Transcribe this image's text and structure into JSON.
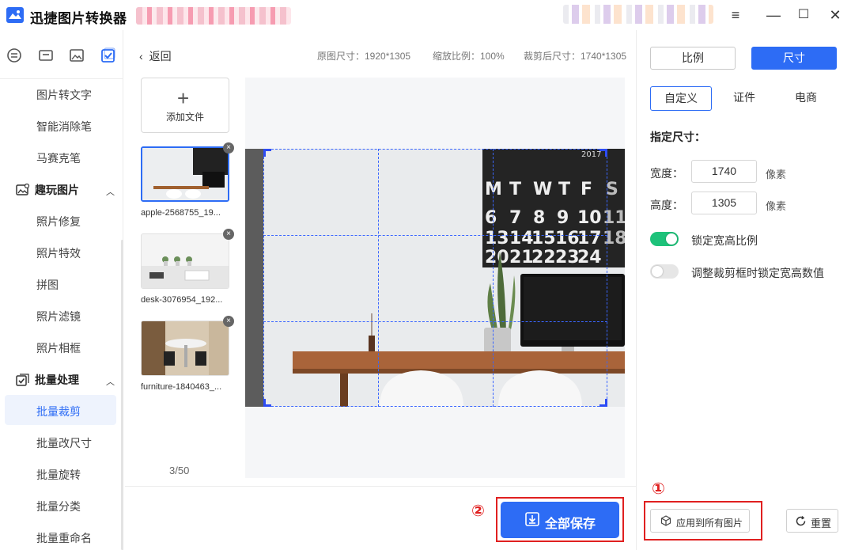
{
  "titlebar": {
    "app_title": "迅捷图片转换器",
    "controls": [
      "≡",
      "—",
      "☐",
      "✕"
    ]
  },
  "sidebar": {
    "top_icons": [
      "convert-icon",
      "layout-icon",
      "image-icon",
      "batch-check-icon"
    ],
    "items": [
      {
        "label": "图片转文字"
      },
      {
        "label": "智能消除笔"
      },
      {
        "label": "马赛克笔"
      }
    ],
    "group_fun": {
      "label": "趣玩图片"
    },
    "fun_items": [
      {
        "label": "照片修复"
      },
      {
        "label": "照片特效"
      },
      {
        "label": "拼图"
      },
      {
        "label": "照片滤镜"
      },
      {
        "label": "照片相框"
      }
    ],
    "group_batch": {
      "label": "批量处理"
    },
    "batch_items": [
      {
        "label": "批量裁剪"
      },
      {
        "label": "批量改尺寸"
      },
      {
        "label": "批量旋转"
      },
      {
        "label": "批量分类"
      },
      {
        "label": "批量重命名"
      }
    ]
  },
  "workspace": {
    "back_label": "返回",
    "original_size": "原图尺寸：1920*1305",
    "zoom": "缩放比例：100%",
    "cropped_size": "裁剪后尺寸：1740*1305",
    "add_file_label": "添加文件",
    "add_file_icon": "+",
    "thumbnails": [
      {
        "name": "apple-2568755_19..."
      },
      {
        "name": "desk-3076954_192..."
      },
      {
        "name": "furniture-1840463_..."
      }
    ],
    "counter": "3/50",
    "save_all_label": "全部保存",
    "annotation_2": "②"
  },
  "right_panel": {
    "mode_tabs": [
      "比例",
      "尺寸"
    ],
    "sub_tabs": [
      "自定义",
      "证件",
      "电商"
    ],
    "section_title": "指定尺寸：",
    "width_label": "宽度：",
    "width_value": "1740",
    "height_label": "高度：",
    "height_value": "1305",
    "unit": "像素",
    "lock_ratio_label": "锁定宽高比例",
    "lock_ratio_on": true,
    "lock_values_label": "调整裁剪框时锁定宽高数值",
    "lock_values_on": false,
    "apply_all_label": "应用到所有图片",
    "reset_label": "重置",
    "annotation_1": "①"
  },
  "colors": {
    "accent": "#2d6cf5",
    "toggle_on": "#1ec27a",
    "annotation_red": "#e02020"
  }
}
